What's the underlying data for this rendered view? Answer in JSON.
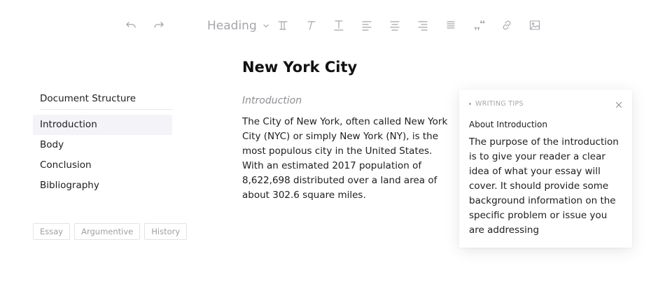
{
  "toolbar": {
    "undo_icon": "undo-icon",
    "redo_icon": "redo-icon",
    "heading_select": "Heading",
    "chevron_icon": "chevron-down-icon",
    "tools": [
      "text-style-icon",
      "italic-icon",
      "underline-icon",
      "align-left-icon",
      "align-center-icon",
      "align-right-icon",
      "align-justify-icon",
      "quote-icon",
      "link-icon",
      "image-icon"
    ],
    "icon_color": "#a6a6ab"
  },
  "document": {
    "title": "New York City",
    "section_label": "Introduction",
    "body": "The City of New York, often called New York City (NYC) or simply New York (NY), is the most populous city in the United States. With an estimated 2017 population of 8,622,698 distributed over a land area of about 302.6 square miles."
  },
  "sidebar": {
    "title": "Document Structure",
    "items": [
      {
        "label": "Introduction",
        "active": true
      },
      {
        "label": "Body",
        "active": false
      },
      {
        "label": "Conclusion",
        "active": false
      },
      {
        "label": "Bibliography",
        "active": false
      }
    ],
    "active_bg": "#f4f4f8"
  },
  "tags": [
    "Essay",
    "Argumentive",
    "History"
  ],
  "tips": {
    "header": "WRITING TIPS",
    "subtitle": "About Introduction",
    "text": "The purpose of the introduction is to give your reader a clear idea of what your essay will cover. It should provide some background information on the specific problem or issue you are addressing",
    "close_icon": "close-icon"
  }
}
